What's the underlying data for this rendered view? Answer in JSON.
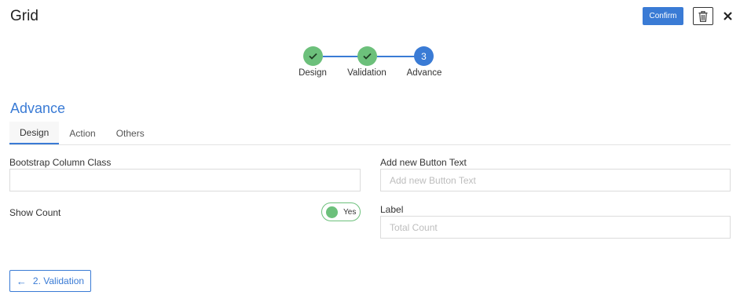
{
  "header": {
    "title": "Grid",
    "confirm_label": "Confirm",
    "trash_icon": "trash-icon",
    "close_icon": "close-icon"
  },
  "stepper": {
    "steps": [
      {
        "label": "Design",
        "status": "done",
        "marker": "✓"
      },
      {
        "label": "Validation",
        "status": "done",
        "marker": "✓"
      },
      {
        "label": "Advance",
        "status": "active",
        "marker": "3"
      }
    ]
  },
  "section": {
    "heading": "Advance"
  },
  "tabs": [
    {
      "label": "Design",
      "active": true
    },
    {
      "label": "Action",
      "active": false
    },
    {
      "label": "Others",
      "active": false
    }
  ],
  "form": {
    "bootstrap_column_class": {
      "label": "Bootstrap Column Class",
      "value": "",
      "placeholder": ""
    },
    "add_new_button_text": {
      "label": "Add new Button Text",
      "value": "",
      "placeholder": "Add new Button Text"
    },
    "show_count": {
      "label": "Show Count",
      "toggle_text": "Yes",
      "on": true
    },
    "count_label": {
      "label": "Label",
      "value": "",
      "placeholder": "Total Count"
    }
  },
  "footer": {
    "prev_label": "2. Validation",
    "prev_icon": "arrow-left-icon"
  },
  "colors": {
    "primary": "#3a7bd5",
    "success": "#6cc07b"
  }
}
